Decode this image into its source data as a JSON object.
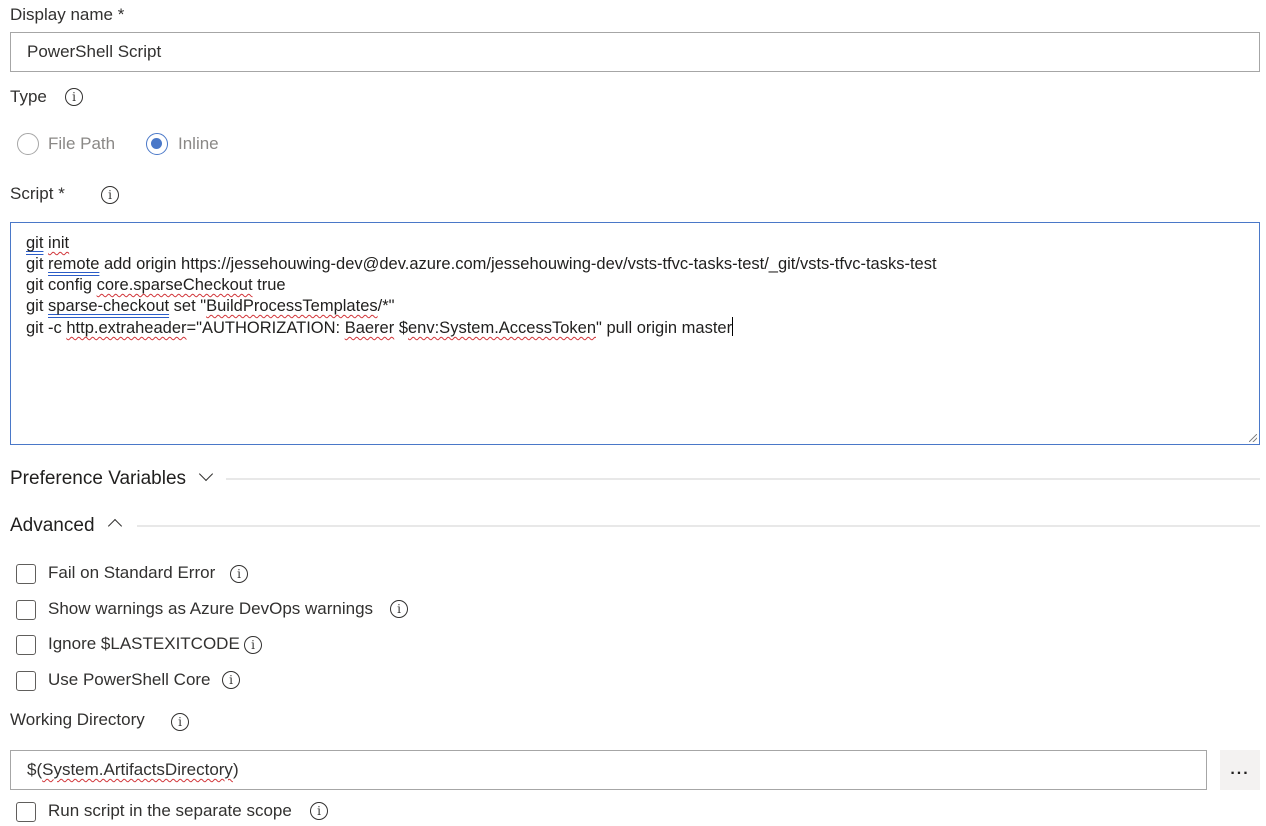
{
  "display_name": {
    "label": "Display name",
    "required_mark": "*",
    "value": "PowerShell Script"
  },
  "type": {
    "label": "Type",
    "info_icon": "info-icon",
    "options": [
      {
        "label": "File Path",
        "selected": false
      },
      {
        "label": "Inline",
        "selected": true
      }
    ]
  },
  "script": {
    "label": "Script",
    "required_mark": "*",
    "info_icon": "info-icon",
    "lines": [
      {
        "segments": [
          {
            "t": "git",
            "s": "blue"
          },
          {
            "t": " "
          },
          {
            "t": "init",
            "s": "red"
          }
        ]
      },
      {
        "segments": [
          {
            "t": "git "
          },
          {
            "t": "remote",
            "s": "blue"
          },
          {
            "t": " add origin https://jessehouwing-dev@dev.azure.com/jessehouwing-dev/vsts-tfvc-tasks-test/_git/vsts-tfvc-tasks-test"
          }
        ]
      },
      {
        "segments": [
          {
            "t": "git config "
          },
          {
            "t": "core.sparseCheckout",
            "s": "red"
          },
          {
            "t": " true"
          }
        ]
      },
      {
        "segments": [
          {
            "t": "git "
          },
          {
            "t": "sparse-checkout",
            "s": "blue"
          },
          {
            "t": " set \""
          },
          {
            "t": "BuildProcessTemplates",
            "s": "red"
          },
          {
            "t": "/*\""
          }
        ]
      },
      {
        "segments": [
          {
            "t": "git -c "
          },
          {
            "t": "http.extraheader",
            "s": "red"
          },
          {
            "t": "=\"AUTHORIZATION: "
          },
          {
            "t": "Baerer",
            "s": "red"
          },
          {
            "t": " $"
          },
          {
            "t": "env:System.AccessToken",
            "s": "red"
          },
          {
            "t": "\" pull origin master"
          }
        ],
        "caret": true
      }
    ]
  },
  "preference_variables": {
    "title": "Preference Variables",
    "expanded": false
  },
  "advanced": {
    "title": "Advanced",
    "expanded": true,
    "checkboxes": [
      {
        "label": "Fail on Standard Error",
        "checked": false
      },
      {
        "label": "Show warnings as Azure DevOps warnings",
        "checked": false
      },
      {
        "label": "Ignore $LASTEXITCODE",
        "checked": false
      },
      {
        "label": "Use PowerShell Core",
        "checked": false
      }
    ]
  },
  "working_directory": {
    "label": "Working Directory",
    "value": "$(System.ArtifactsDirectory)",
    "browse_label": "..."
  },
  "separate_scope": {
    "label": "Run script in the separate scope",
    "checked": false
  },
  "colors": {
    "accent": "#4a78c8",
    "spell_error": "#d13438",
    "grammar_mark": "#2b5cc7"
  }
}
